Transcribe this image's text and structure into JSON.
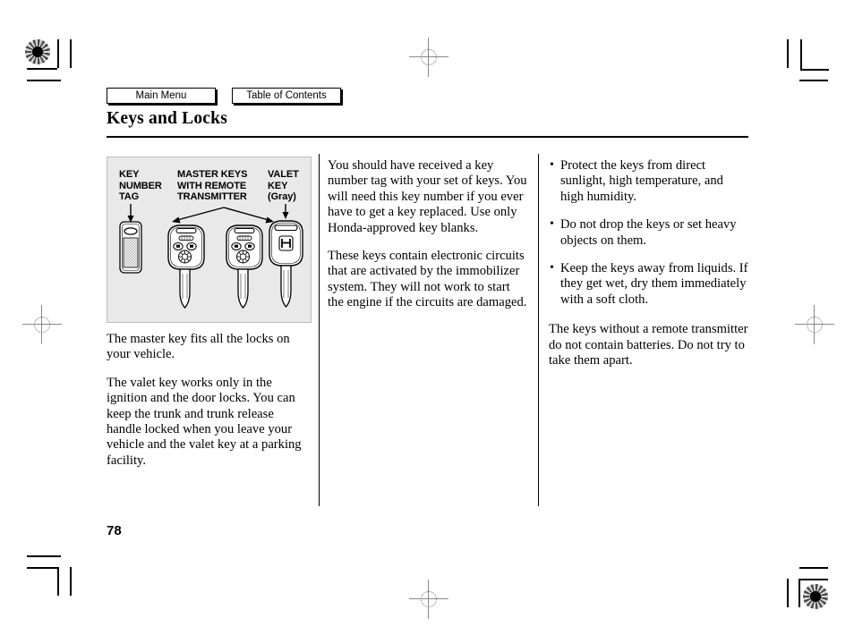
{
  "nav": {
    "main_menu": "Main Menu",
    "table_of_contents": "Table of Contents"
  },
  "header": {
    "title": "Keys and Locks"
  },
  "figure": {
    "labels": {
      "key_number_tag": "KEY\nNUMBER\nTAG",
      "master_keys": "MASTER KEYS\nWITH REMOTE\nTRANSMITTER",
      "valet_key": "VALET\nKEY\n(Gray)"
    },
    "items": [
      {
        "name": "key-number-tag",
        "icon": "key-tag-icon"
      },
      {
        "name": "master-key-left",
        "icon": "remote-key-fob-icon"
      },
      {
        "name": "master-key-right",
        "icon": "remote-key-fob-icon"
      },
      {
        "name": "valet-key",
        "icon": "honda-key-icon"
      }
    ],
    "background_color": "#e9e9e9"
  },
  "columns": {
    "left": {
      "paragraphs": [
        "The master key fits all the locks on your vehicle.",
        "The valet key works only in the ignition and the door locks. You can keep the trunk and trunk release handle locked when you leave your vehicle and the valet key at a parking facility."
      ]
    },
    "middle": {
      "paragraphs": [
        "You should have received a key number tag with your set of keys. You will need this key number if you ever have to get a key replaced. Use only Honda-approved key blanks.",
        "These keys contain electronic circuits that are activated by the immobilizer system. They will not work to start the engine if the circuits are damaged."
      ]
    },
    "right": {
      "bullets": [
        "Protect the keys from direct sunlight, high temperature, and high humidity.",
        "Do not drop the keys or set heavy objects on them.",
        "Keep the keys away from liquids. If they get wet, dry them immediately with a soft cloth."
      ],
      "paragraphs": [
        "The keys without a remote transmitter do not contain batteries. Do not try to take them apart."
      ]
    }
  },
  "footer": {
    "page_number": "78"
  }
}
